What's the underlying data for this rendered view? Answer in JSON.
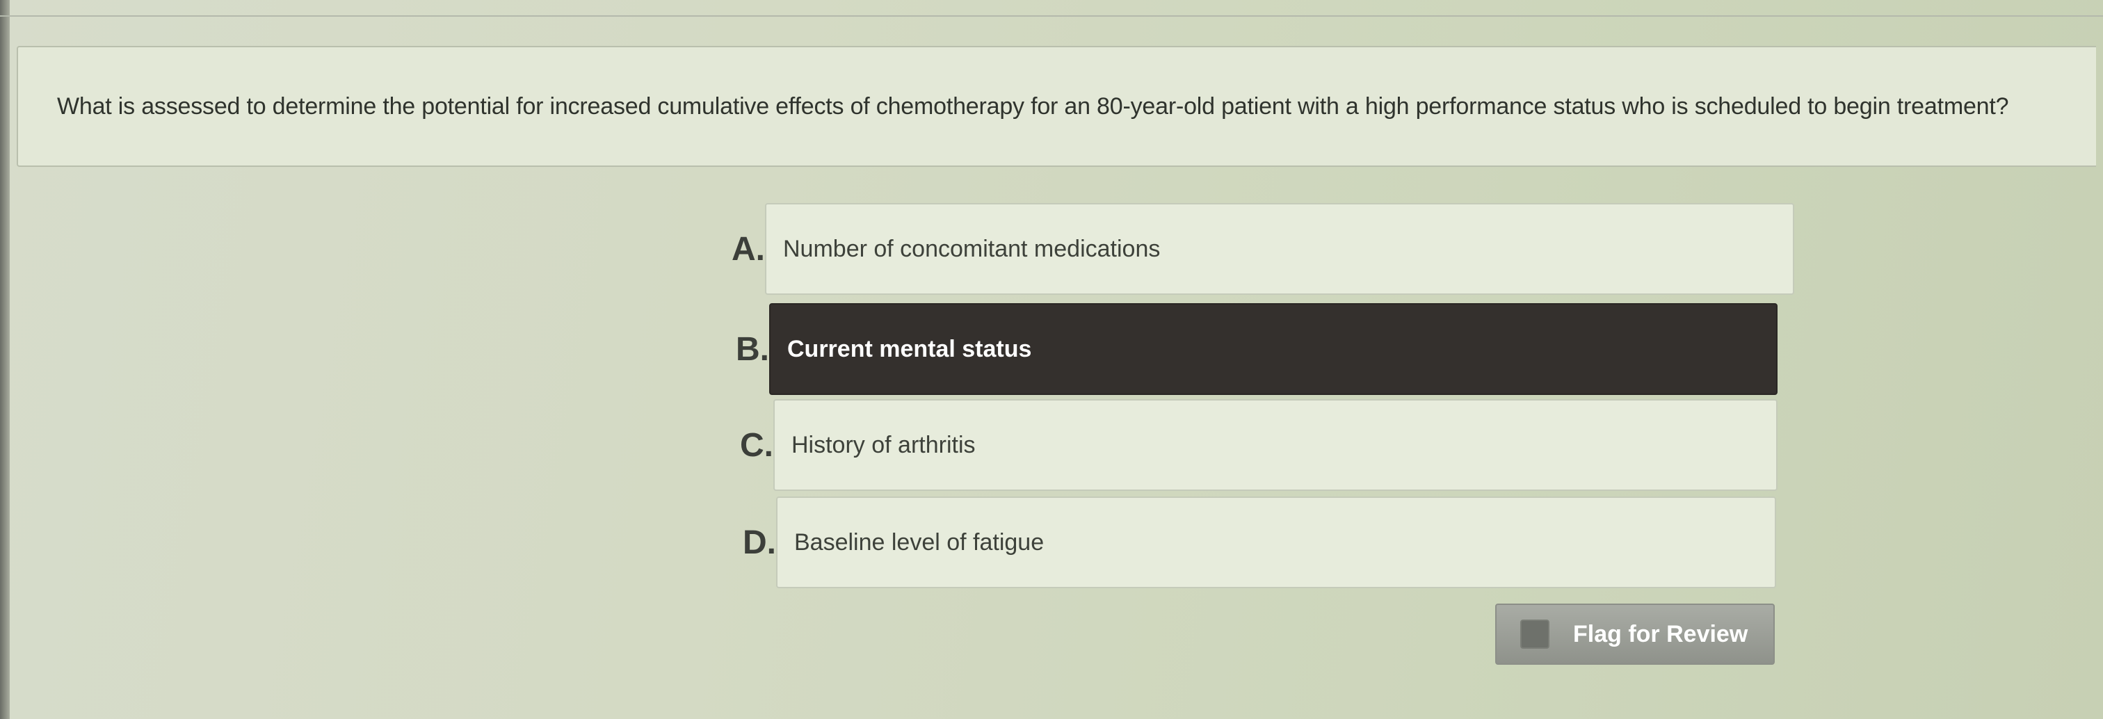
{
  "question": {
    "text": "What is assessed to determine the potential for increased cumulative effects of chemotherapy for an 80-year-old patient with a high performance status who is scheduled to begin treatment?"
  },
  "answers": [
    {
      "letter": "A.",
      "text": "Number of concomitant medications",
      "selected": false
    },
    {
      "letter": "B.",
      "text": "Current mental status",
      "selected": true
    },
    {
      "letter": "C.",
      "text": "History of arthritis",
      "selected": false
    },
    {
      "letter": "D.",
      "text": "Baseline level of fatigue",
      "selected": false
    }
  ],
  "flag": {
    "label": "Flag for Review",
    "checked": false
  },
  "colors": {
    "selected_bg": "#34302d",
    "selected_text": "#ffffff",
    "answer_bg": "#e7ecdc",
    "page_bg": "#d4dac4"
  }
}
